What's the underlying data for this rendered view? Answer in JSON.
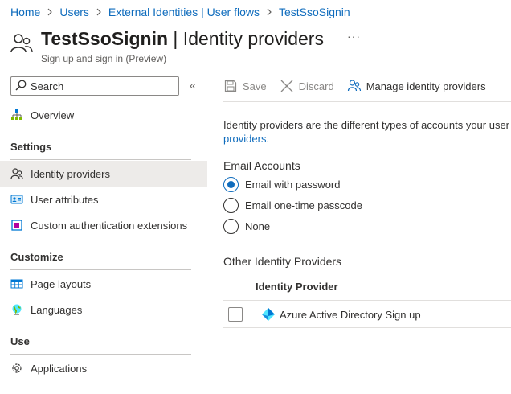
{
  "breadcrumb": [
    "Home",
    "Users",
    "External Identities | User flows",
    "TestSsoSignin"
  ],
  "header": {
    "title_strong": "TestSsoSignin",
    "title_rest": " | Identity providers",
    "subtitle": "Sign up and sign in (Preview)",
    "more": "···"
  },
  "sidebar": {
    "search_placeholder": "Search",
    "collapse": "«",
    "overview": "Overview",
    "sections": {
      "settings": "Settings",
      "customize": "Customize",
      "use": "Use"
    },
    "items": {
      "identity_providers": "Identity providers",
      "user_attributes": "User attributes",
      "custom_auth": "Custom authentication extensions",
      "page_layouts": "Page layouts",
      "languages": "Languages",
      "applications": "Applications"
    }
  },
  "toolbar": {
    "save": "Save",
    "discard": "Discard",
    "manage": "Manage identity providers"
  },
  "content": {
    "description_line1": "Identity providers are the different types of accounts your user",
    "description_link": "providers.",
    "email_group": "Email Accounts",
    "email_options": [
      "Email with password",
      "Email one-time passcode",
      "None"
    ],
    "email_selected": "Email with password",
    "other_group": "Other Identity Providers",
    "table_header": "Identity Provider",
    "rows": [
      "Azure Active Directory Sign up"
    ]
  },
  "colors": {
    "accent": "#0f6cbd",
    "selected_bg": "#edebe9"
  }
}
